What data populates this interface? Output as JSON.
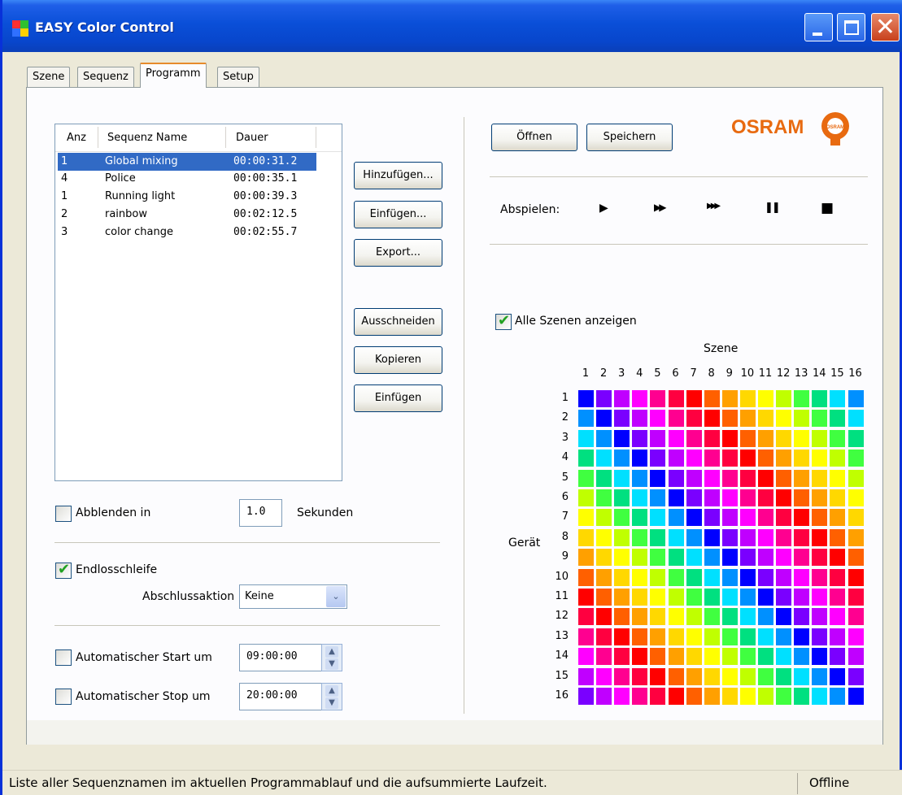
{
  "window": {
    "title": "EASY Color Control"
  },
  "tabs": [
    {
      "label": "Szene",
      "active": false
    },
    {
      "label": "Sequenz",
      "active": false
    },
    {
      "label": "Programm",
      "active": true
    },
    {
      "label": "Setup",
      "active": false
    }
  ],
  "sequence_list": {
    "headers": [
      "Anz",
      "Sequenz Name",
      "Dauer"
    ],
    "rows": [
      {
        "count": "1",
        "name": "Global mixing",
        "duration": "00:00:31.2",
        "selected": true
      },
      {
        "count": "4",
        "name": "Police",
        "duration": "00:00:35.1",
        "selected": false
      },
      {
        "count": "1",
        "name": "Running light",
        "duration": "00:00:39.3",
        "selected": false
      },
      {
        "count": "2",
        "name": "rainbow",
        "duration": "00:02:12.5",
        "selected": false
      },
      {
        "count": "3",
        "name": "color change",
        "duration": "00:02:55.7",
        "selected": false
      }
    ]
  },
  "list_buttons": {
    "add": "Hinzufügen...",
    "insert": "Einfügen...",
    "export": "Export...",
    "cut": "Ausschneiden",
    "copy": "Kopieren",
    "paste": "Einfügen"
  },
  "fade": {
    "label": "Abblenden in",
    "value": "1.0",
    "unit": "Sekunden",
    "checked": false
  },
  "loop": {
    "label": "Endlosschleife",
    "checked": true,
    "end_action_label": "Abschlussaktion",
    "end_action_value": "Keine"
  },
  "auto_start": {
    "label": "Automatischer Start um",
    "value": "09:00:00",
    "checked": false
  },
  "auto_stop": {
    "label": "Automatischer Stop um",
    "value": "20:00:00",
    "checked": false
  },
  "file_buttons": {
    "open": "Öffnen",
    "save": "Speichern"
  },
  "brand": {
    "logo": "OSRAM",
    "bulb_text": "OSRAM",
    "color": "#e86a10"
  },
  "playback": {
    "label": "Abspielen:",
    "controls": [
      {
        "icon": "play-icon",
        "glyph": "▶"
      },
      {
        "icon": "fast-forward-icon",
        "glyph": "▶▶"
      },
      {
        "icon": "faster-forward-icon",
        "glyph": "▶▶▶"
      },
      {
        "icon": "pause-icon",
        "glyph": "❚❚"
      },
      {
        "icon": "stop-icon",
        "glyph": "■"
      }
    ]
  },
  "scenes": {
    "show_all_label": "Alle Szenen anzeigen",
    "show_all_checked": true,
    "axis_label_scene": "Szene",
    "axis_label_device": "Gerät",
    "scene_numbers": [
      "1",
      "2",
      "3",
      "4",
      "5",
      "6",
      "7",
      "8",
      "9",
      "10",
      "11",
      "12",
      "13",
      "14",
      "15",
      "16"
    ],
    "device_numbers": [
      "1",
      "2",
      "3",
      "4",
      "5",
      "6",
      "7",
      "8",
      "9",
      "10",
      "11",
      "12",
      "13",
      "14",
      "15",
      "16"
    ],
    "palette": [
      "#0000ff",
      "#7a00ff",
      "#c000ff",
      "#ff00ff",
      "#ff0090",
      "#ff0040",
      "#ff0000",
      "#ff6000",
      "#ffa000",
      "#ffd800",
      "#ffff00",
      "#c0ff00",
      "#40ff40",
      "#00e080",
      "#00e0ff",
      "#0090ff"
    ],
    "row_offsets": [
      0,
      15,
      14,
      13,
      15,
      14,
      14,
      13,
      15,
      15,
      14,
      13,
      12,
      11,
      10,
      9
    ],
    "row_shift": [
      0,
      0,
      0,
      0,
      0,
      0,
      0,
      0,
      0,
      0,
      0,
      0,
      0,
      0,
      0,
      0
    ]
  },
  "status": {
    "message": "Liste aller Sequenznamen im aktuellen Programmablauf und die aufsummierte Laufzeit.",
    "connection": "Offline"
  }
}
